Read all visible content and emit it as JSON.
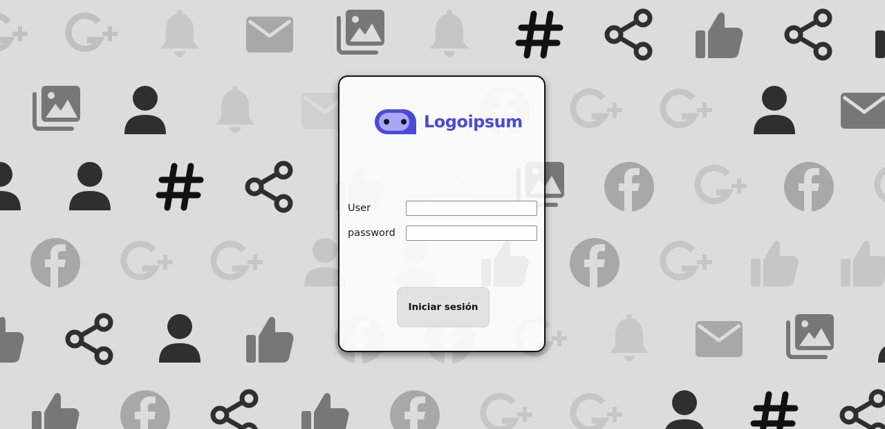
{
  "login": {
    "logo_text": "Logoipsum",
    "user_label": "User",
    "password_label": "password",
    "user_value": "",
    "password_value": "",
    "submit_label": "Iniciar sesión"
  },
  "colors": {
    "page_background": "#dcdcdc",
    "card_background": "#ffffff",
    "brand": "#4a4ad8",
    "brand_light": "#a9a6f5",
    "button_background": "#e2e2e2"
  },
  "background_pattern": {
    "icons": [
      "bell-icon",
      "envelope-icon",
      "images-icon",
      "hashtag-icon",
      "share-icon",
      "thumbs-up-icon",
      "user-icon",
      "facebook-icon",
      "google-plus-icon"
    ],
    "rows": [
      [
        [
          "google-plus-icon",
          "#c0c0c0"
        ],
        [
          "google-plus-icon",
          "#c0c0c0"
        ],
        [
          "bell-icon",
          "#c8c8c8"
        ],
        [
          "envelope-icon",
          "#a8a8a8"
        ],
        [
          "images-icon",
          "#777777"
        ],
        [
          "bell-icon",
          "#c6c6c6"
        ],
        [
          "hashtag-icon",
          "#111111"
        ],
        [
          "share-icon",
          "#2f2f2f"
        ],
        [
          "thumbs-up-icon",
          "#777777"
        ],
        [
          "share-icon",
          "#2f2f2f"
        ],
        [
          "thumbs-up-icon",
          "#2f2f2f"
        ]
      ],
      [
        [
          "envelope-icon",
          "#a8a8a8"
        ],
        [
          "images-icon",
          "#777777"
        ],
        [
          "user-icon",
          "#2f2f2f"
        ],
        [
          "bell-icon",
          "#c8c8c8"
        ],
        [
          "envelope-icon",
          "#d0d0d0"
        ],
        [
          "images-icon",
          "#d0d0d0"
        ],
        [
          "facebook-icon",
          "#c8c8c8"
        ],
        [
          "google-plus-icon",
          "#c6c6c6"
        ],
        [
          "google-plus-icon",
          "#c6c6c6"
        ],
        [
          "user-icon",
          "#2f2f2f"
        ],
        [
          "envelope-icon",
          "#777777"
        ]
      ],
      [
        [
          "user-icon",
          "#2f2f2f"
        ],
        [
          "user-icon",
          "#2f2f2f"
        ],
        [
          "hashtag-icon",
          "#111111"
        ],
        [
          "share-icon",
          "#2f2f2f"
        ],
        [
          "thumbs-up-icon",
          "#c6c6c6"
        ],
        [
          "envelope-icon",
          "#d0d0d0"
        ],
        [
          "images-icon",
          "#777777"
        ],
        [
          "facebook-icon",
          "#a8a8a8"
        ],
        [
          "google-plus-icon",
          "#c6c6c6"
        ],
        [
          "facebook-icon",
          "#a8a8a8"
        ],
        [
          "google-plus-icon",
          "#c6c6c6"
        ]
      ],
      [
        [
          "thumbs-up-icon",
          "#777777"
        ],
        [
          "facebook-icon",
          "#a8a8a8"
        ],
        [
          "google-plus-icon",
          "#c6c6c6"
        ],
        [
          "google-plus-icon",
          "#c6c6c6"
        ],
        [
          "user-icon",
          "#c6c6c6"
        ],
        [
          "user-icon",
          "#c6c6c6"
        ],
        [
          "thumbs-up-icon",
          "#777777"
        ],
        [
          "facebook-icon",
          "#a8a8a8"
        ],
        [
          "google-plus-icon",
          "#c6c6c6"
        ],
        [
          "thumbs-up-icon",
          "#c6c6c6"
        ],
        [
          "thumbs-up-icon",
          "#c6c6c6"
        ]
      ],
      [
        [
          "thumbs-up-icon",
          "#777777"
        ],
        [
          "share-icon",
          "#2f2f2f"
        ],
        [
          "user-icon",
          "#2f2f2f"
        ],
        [
          "thumbs-up-icon",
          "#777777"
        ],
        [
          "facebook-icon",
          "#c6c6c6"
        ],
        [
          "facebook-icon",
          "#c6c6c6"
        ],
        [
          "google-plus-icon",
          "#c6c6c6"
        ],
        [
          "bell-icon",
          "#c8c8c8"
        ],
        [
          "envelope-icon",
          "#a8a8a8"
        ],
        [
          "images-icon",
          "#777777"
        ],
        [
          "user-icon",
          "#2f2f2f"
        ]
      ],
      [
        [
          "user-icon",
          "#2f2f2f"
        ],
        [
          "thumbs-up-icon",
          "#777777"
        ],
        [
          "facebook-icon",
          "#a8a8a8"
        ],
        [
          "share-icon",
          "#2f2f2f"
        ],
        [
          "thumbs-up-icon",
          "#777777"
        ],
        [
          "facebook-icon",
          "#a8a8a8"
        ],
        [
          "google-plus-icon",
          "#c6c6c6"
        ],
        [
          "google-plus-icon",
          "#c6c6c6"
        ],
        [
          "user-icon",
          "#2f2f2f"
        ],
        [
          "hashtag-icon",
          "#111111"
        ],
        [
          "share-icon",
          "#2f2f2f"
        ]
      ]
    ]
  }
}
